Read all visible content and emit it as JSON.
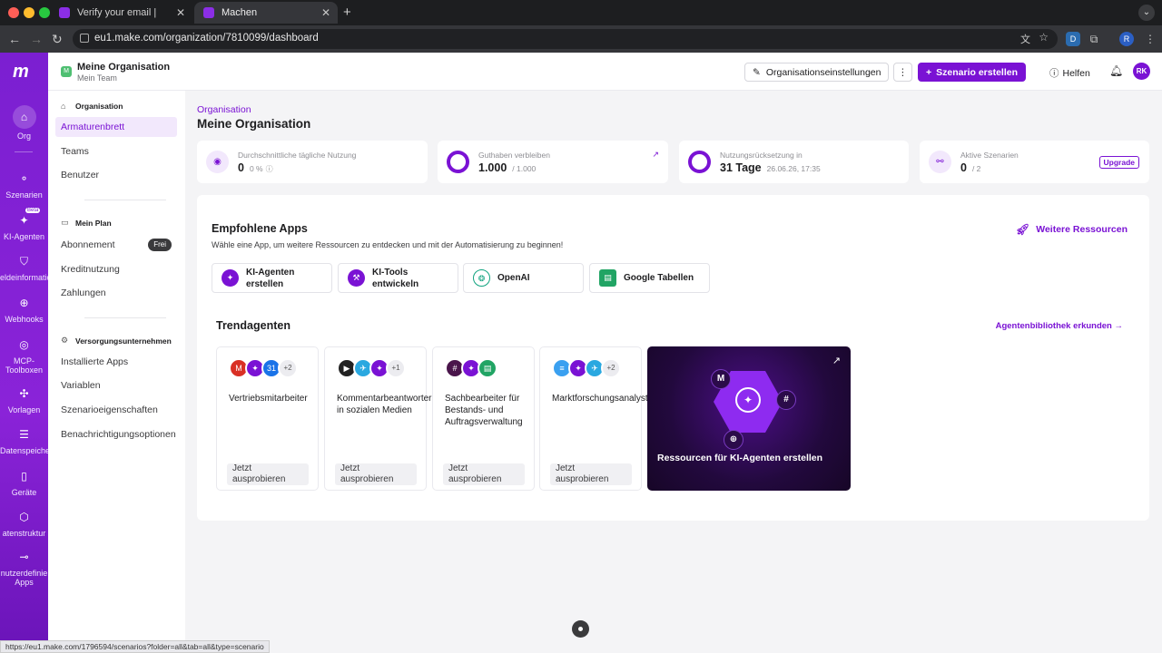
{
  "browser": {
    "tabs": [
      {
        "title": "Verify your email |"
      },
      {
        "title": "Machen"
      }
    ],
    "url": "eu1.make.com/organization/7810099/dashboard",
    "status_url": "https://eu1.make.com/1796594/scenarios?folder=all&tab=all&type=scenario",
    "profile_initial": "R",
    "ext_initial": "D"
  },
  "rail": {
    "items": [
      {
        "label": "Org"
      },
      {
        "label": "Szenarien"
      },
      {
        "label": "KI-Agenten",
        "badge": "Beta"
      },
      {
        "label": "eldeinformatio"
      },
      {
        "label": "Webhooks"
      },
      {
        "label": "MCP-\nToolboxen"
      },
      {
        "label": "Vorlagen"
      },
      {
        "label": "Datenspeiche"
      },
      {
        "label": "Geräte"
      },
      {
        "label": "atenstruktur"
      },
      {
        "label": "nutzerdefinie\nApps"
      }
    ]
  },
  "topbar": {
    "org_initial": "M",
    "org_name": "Meine Organisation",
    "team": "Mein Team",
    "settings_label": "Organisationseinstellungen",
    "create_label": "Szenario erstellen",
    "help_label": "Helfen",
    "avatar": "RK"
  },
  "subnav": {
    "section1": "Organisation",
    "items1": [
      "Armaturenbrett",
      "Teams",
      "Benutzer"
    ],
    "section2": "Mein Plan",
    "items2": [
      "Abonnement",
      "Kreditnutzung",
      "Zahlungen"
    ],
    "plan_badge": "Frei",
    "section3": "Versorgungsunternehmen",
    "items3": [
      "Installierte Apps",
      "Variablen",
      "Szenarioeigenschaften",
      "Benachrichtigungsoptionen"
    ]
  },
  "page": {
    "crumb": "Organisation",
    "title": "Meine Organisation"
  },
  "stats": [
    {
      "label": "Durchschnittliche tägliche Nutzung",
      "value": "0",
      "sub": "0 %"
    },
    {
      "label": "Guthaben verbleiben",
      "value": "1.000",
      "sub": "/  1.000"
    },
    {
      "label": "Nutzungsrücksetzung in",
      "value": "31 Tage",
      "sub": "26.06.26, 17:35"
    },
    {
      "label": "Aktive Szenarien",
      "value": "0",
      "sub": "/  2",
      "button": "Upgrade"
    }
  ],
  "recommended": {
    "title": "Empfohlene Apps",
    "subtitle": "Wähle eine App, um weitere Ressourcen zu entdecken und mit der Automatisierung zu beginnen!",
    "more_link": "Weitere Ressourcen",
    "apps": [
      {
        "label": "KI-Agenten erstellen",
        "color": "#7a12d4"
      },
      {
        "label": "KI-Tools entwickeln",
        "color": "#7a12d4"
      },
      {
        "label": "OpenAI",
        "color": "#10a37f"
      },
      {
        "label": "Google Tabellen",
        "color": "#21a464"
      }
    ]
  },
  "trending": {
    "title": "Trendagenten",
    "library_link": "Agentenbibliothek erkunden →",
    "agents": [
      {
        "name": "Vertriebsmitarbeiter",
        "extra": "+2",
        "try": "Jetzt ausprobieren",
        "icons": [
          "#d93025",
          "#7a12d4",
          "#1a73e8"
        ],
        "glyphs": [
          "M",
          "✦",
          "31"
        ]
      },
      {
        "name": "Kommentarbeantworter in sozialen Medien",
        "extra": "+1",
        "try": "Jetzt ausprobieren",
        "icons": [
          "#222222",
          "#2aa8e0",
          "#7a12d4"
        ],
        "glyphs": [
          "▶",
          "✈",
          "✦"
        ]
      },
      {
        "name": "Sachbearbeiter für Bestands- und Auftragsverwaltung",
        "extra": "",
        "try": "Jetzt ausprobieren",
        "icons": [
          "#4a154b",
          "#7a12d4",
          "#21a464"
        ],
        "glyphs": [
          "#",
          "✦",
          "▤"
        ]
      },
      {
        "name": "Marktforschungsanalyst",
        "extra": "+2",
        "try": "Jetzt ausprobieren",
        "icons": [
          "#3aa0f0",
          "#7a12d4",
          "#2aa8e0"
        ],
        "glyphs": [
          "≡",
          "✦",
          "✈"
        ]
      }
    ],
    "promo": "Ressourcen für KI-Agenten erstellen"
  },
  "colors": {
    "accent": "#7a12d4"
  }
}
